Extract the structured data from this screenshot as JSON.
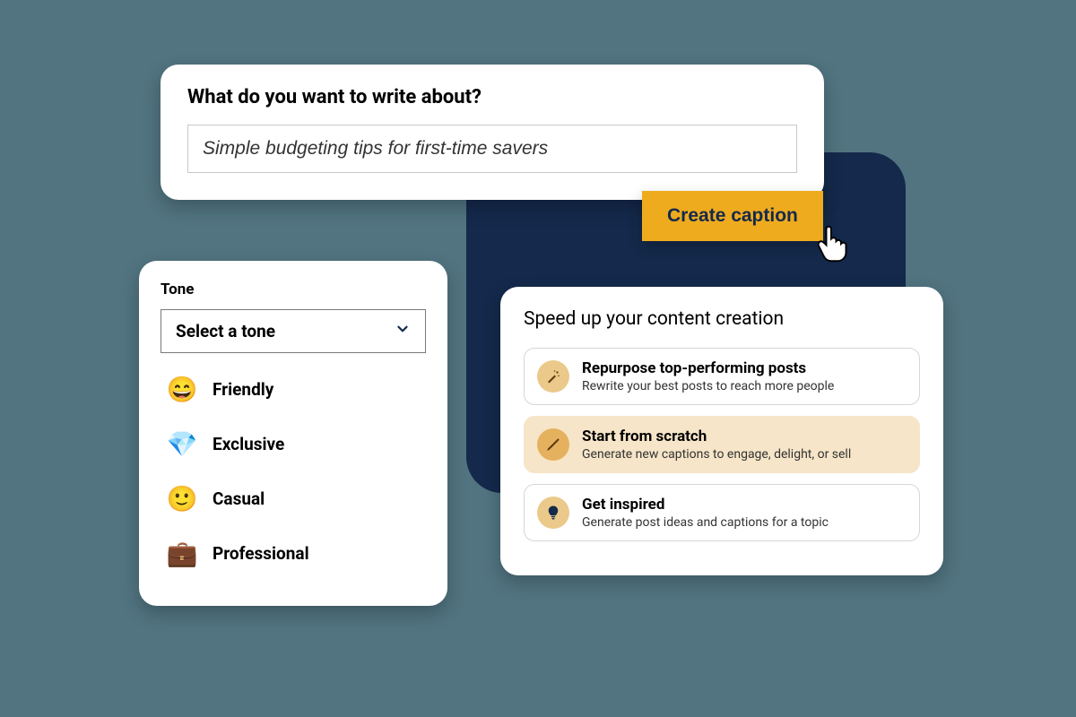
{
  "prompt": {
    "heading": "What do you want to write about?",
    "value": "Simple budgeting tips for first-time savers"
  },
  "create_button": "Create caption",
  "tone": {
    "label": "Tone",
    "placeholder": "Select a tone",
    "options": [
      {
        "emoji": "😄",
        "label": "Friendly"
      },
      {
        "emoji": "💎",
        "label": "Exclusive"
      },
      {
        "emoji": "🙂",
        "label": "Casual"
      },
      {
        "emoji": "💼",
        "label": "Professional"
      }
    ]
  },
  "content": {
    "heading": "Speed up your content creation",
    "actions": [
      {
        "icon": "magic-wand-icon",
        "title": "Repurpose top-performing posts",
        "subtitle": "Rewrite your best posts to reach more people",
        "selected": false
      },
      {
        "icon": "pencil-icon",
        "title": "Start from scratch",
        "subtitle": "Generate new captions to engage, delight, or sell",
        "selected": true
      },
      {
        "icon": "lightbulb-icon",
        "title": "Get inspired",
        "subtitle": "Generate post ideas and captions for a topic",
        "selected": false
      }
    ]
  }
}
